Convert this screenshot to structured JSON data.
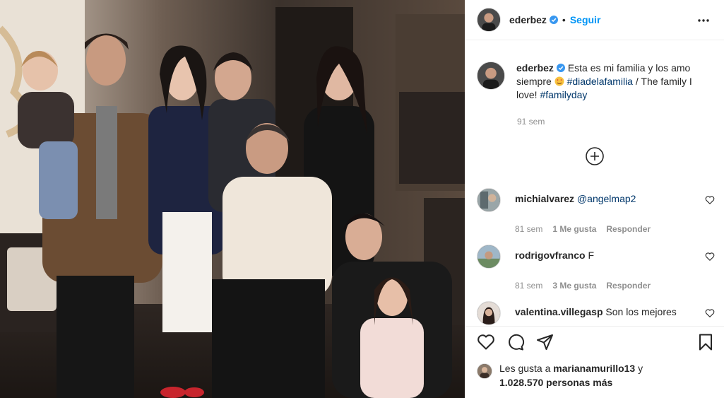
{
  "post": {
    "username": "ederbez",
    "follow_label": "Seguir",
    "caption": {
      "text_part1": "Esta es mi familia y los amo siempre",
      "hashtag1": "#diadelafamilia",
      "text_part2": "/ The family I love!",
      "hashtag2": "#familyday"
    },
    "caption_time": "91 sem",
    "accent_color": "#0095f6",
    "link_color": "#00376b"
  },
  "comments": [
    {
      "username": "michialvarez",
      "mention": "@angelmap2",
      "text": "",
      "time": "81 sem",
      "likes": "1 Me gusta",
      "reply": "Responder"
    },
    {
      "username": "rodrigovfranco",
      "mention": "",
      "text": "F",
      "time": "81 sem",
      "likes": "3 Me gusta",
      "reply": "Responder"
    },
    {
      "username": "valentina.villegasp",
      "mention": "",
      "text": "Son los mejores",
      "time": "",
      "likes": "",
      "reply": ""
    }
  ],
  "likes": {
    "prefix": "Les gusta a",
    "user": "marianamurillo13",
    "conj": "y",
    "others": "1.028.570 personas más"
  },
  "icons": [
    "more-icon",
    "verified-icon",
    "heart-icon",
    "comment-icon",
    "share-icon",
    "save-icon",
    "add-comments-icon"
  ]
}
